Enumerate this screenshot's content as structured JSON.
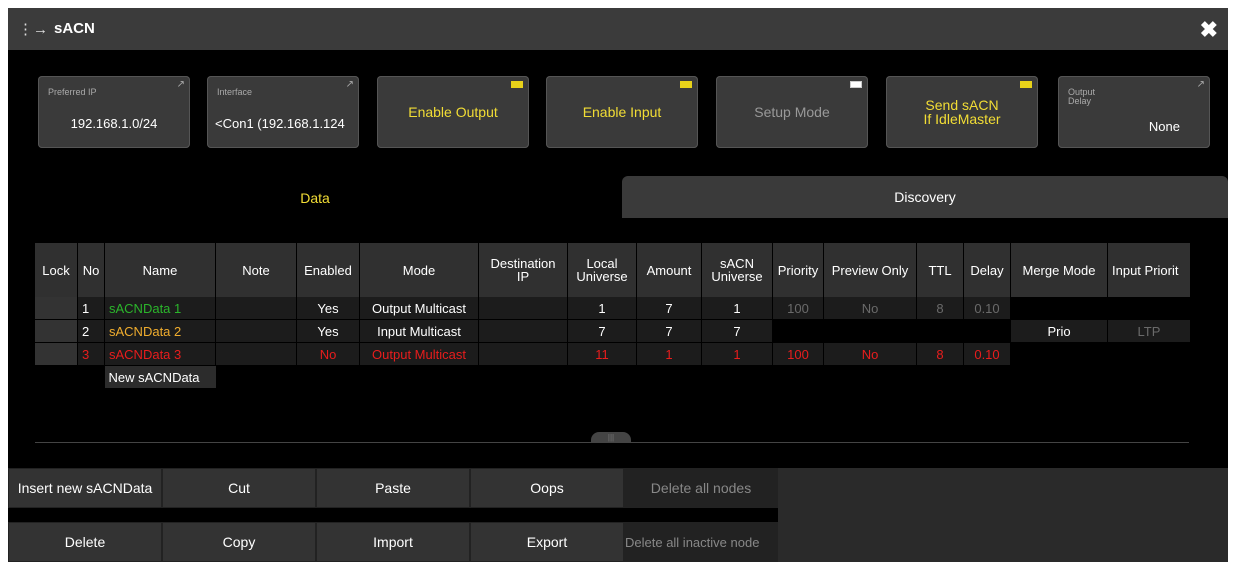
{
  "window": {
    "title": "sACN",
    "title_icon": "network-nodes-icon",
    "close_icon": "close-x-icon"
  },
  "toolbar": {
    "preferred_ip": {
      "label": "Preferred IP",
      "value": "192.168.1.0/24"
    },
    "interface": {
      "label": "Interface",
      "value": "<Con1 (192.168.1.124"
    },
    "enable_output": {
      "label": "Enable Output",
      "led": "on"
    },
    "enable_input": {
      "label": "Enable Input",
      "led": "on"
    },
    "setup_mode": {
      "label": "Setup Mode",
      "led": "off"
    },
    "send_sacn": {
      "line1": "Send sACN",
      "line2": "If IdleMaster",
      "led": "on"
    },
    "output_delay": {
      "label_line1": "Output",
      "label_line2": "Delay",
      "value": "None"
    }
  },
  "tabs": {
    "data": "Data",
    "discovery": "Discovery"
  },
  "table": {
    "headers": {
      "lock": "Lock",
      "no": "No",
      "name": "Name",
      "note": "Note",
      "enabled": "Enabled",
      "mode": "Mode",
      "dest_ip_1": "Destination",
      "dest_ip_2": "IP",
      "local_universe_1": "Local",
      "local_universe_2": "Universe",
      "amount": "Amount",
      "sacn_universe_1": "sACN",
      "sacn_universe_2": "Universe",
      "priority": "Priority",
      "preview_only": "Preview Only",
      "ttl": "TTL",
      "delay": "Delay",
      "merge_mode": "Merge Mode",
      "input_priority": "Input Priorit"
    },
    "rows": [
      {
        "no": "1",
        "name": "sACNData 1",
        "note": "",
        "enabled": "Yes",
        "mode": "Output Multicast",
        "dest_ip": "",
        "local_universe": "1",
        "amount": "7",
        "sacn_universe": "1",
        "priority": "100",
        "preview_only": "No",
        "ttl": "8",
        "delay": "0.10",
        "merge_mode": "",
        "input_priority": ""
      },
      {
        "no": "2",
        "name": "sACNData 2",
        "note": "",
        "enabled": "Yes",
        "mode": "Input Multicast",
        "dest_ip": "",
        "local_universe": "7",
        "amount": "7",
        "sacn_universe": "7",
        "priority": "",
        "preview_only": "",
        "ttl": "",
        "delay": "",
        "merge_mode": "Prio",
        "input_priority": "LTP"
      },
      {
        "no": "3",
        "name": "sACNData 3",
        "note": "",
        "enabled": "No",
        "mode": "Output Multicast",
        "dest_ip": "",
        "local_universe": "11",
        "amount": "1",
        "sacn_universe": "1",
        "priority": "100",
        "preview_only": "No",
        "ttl": "8",
        "delay": "0.10",
        "merge_mode": "",
        "input_priority": ""
      }
    ],
    "new_row_label": "New sACNData"
  },
  "bottom_buttons": {
    "insert": "Insert new sACNData",
    "cut": "Cut",
    "paste": "Paste",
    "oops": "Oops",
    "delete_all_nodes": "Delete all nodes",
    "delete": "Delete",
    "copy": "Copy",
    "import": "Import",
    "export": "Export",
    "delete_inactive": "Delete all inactive node"
  },
  "colors": {
    "accent_yellow": "#f2dd35",
    "row1_green": "#2bb52b",
    "row2_orange": "#f0ad2e",
    "row3_red": "#e81d1d",
    "panel": "#3a3a3a"
  }
}
